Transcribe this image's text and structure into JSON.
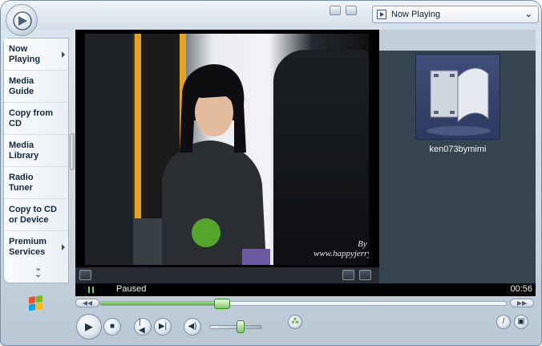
{
  "title_bar": {
    "logo": "media-player-logo-icon"
  },
  "playlist_select": {
    "icon": "now-playing-icon",
    "selected": "Now Playing"
  },
  "taskbar": {
    "items": [
      {
        "line1": "Now",
        "line2": "Playing",
        "active": true,
        "has_arrow": true
      },
      {
        "line1": "Media",
        "line2": "Guide",
        "active": false,
        "has_arrow": false
      },
      {
        "line1": "Copy from",
        "line2": "CD",
        "active": false,
        "has_arrow": false
      },
      {
        "line1": "Media",
        "line2": "Library",
        "active": false,
        "has_arrow": false
      },
      {
        "line1": "Radio",
        "line2": "Tuner",
        "active": false,
        "has_arrow": false
      },
      {
        "line1": "Copy to CD",
        "line2": "or Device",
        "active": false,
        "has_arrow": false
      },
      {
        "line1": "Premium",
        "line2": "Services",
        "active": false,
        "has_arrow": true
      }
    ],
    "more_icon": "double-chevron-down-icon",
    "brand_icon": "windows-flag-icon"
  },
  "video": {
    "credit_line1": "By Mimi",
    "credit_line2": "www.happyjerry.com"
  },
  "video_controls": {
    "left_icon": "full-mode-icon",
    "right_icons": [
      "fit-video-icon",
      "fullscreen-icon"
    ]
  },
  "now_playing_panel": {
    "item_name": "ken073bymimi",
    "thumbnail_icon": "film-strip-icon"
  },
  "status": {
    "text": "Paused",
    "time": "00:56",
    "indicator_color": "#64d24a"
  },
  "seek": {
    "progress": 0.3,
    "rewind_icon": "rewind-icon",
    "forward_icon": "fast-forward-icon"
  },
  "transport": {
    "play_icon": "play-icon",
    "stop_icon": "stop-icon",
    "previous_icon": "previous-icon",
    "next_icon": "next-icon",
    "mute_icon": "speaker-icon",
    "volume": 0.6,
    "shuffle_icon": "shuffle-icon",
    "skin_icon": "skin-mode-icon",
    "mini_icon": "mini-player-icon"
  },
  "colors": {
    "accent_green": "#54b038",
    "panel_dark": "#35454f"
  }
}
